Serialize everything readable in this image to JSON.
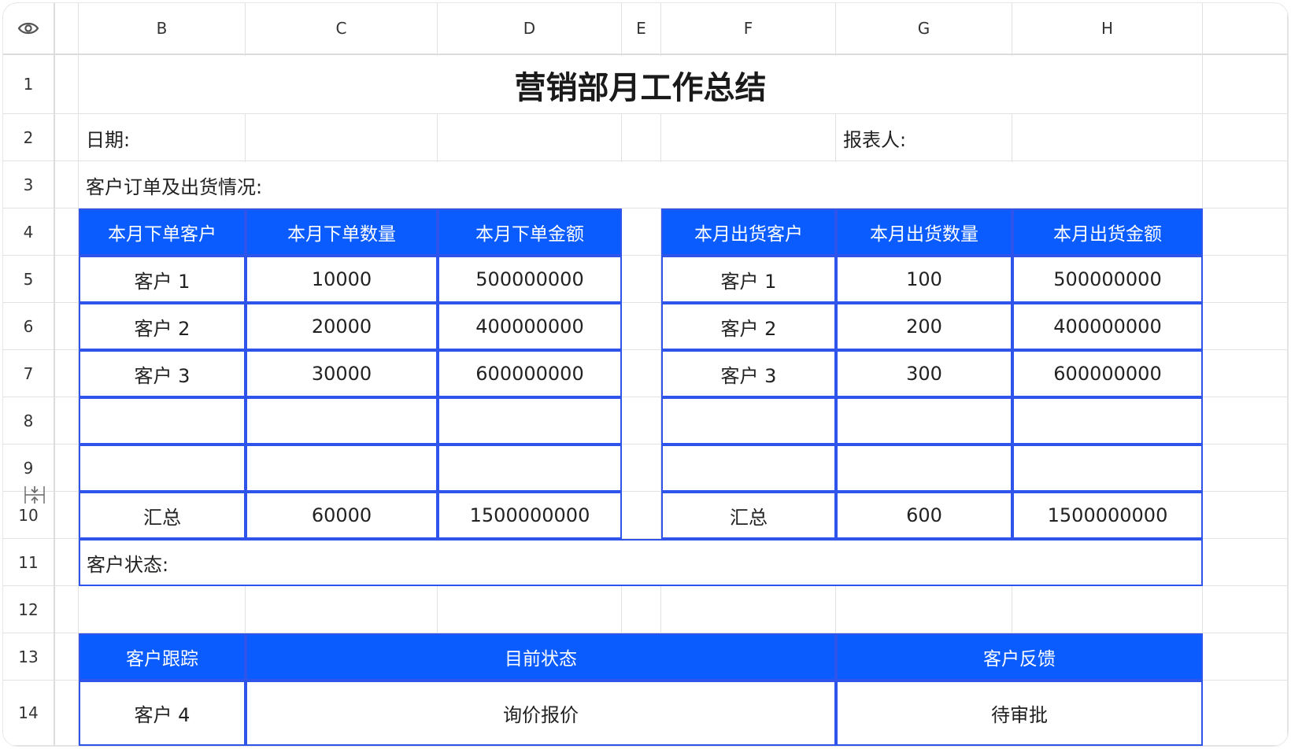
{
  "columns": [
    "B",
    "C",
    "D",
    "E",
    "F",
    "G",
    "H"
  ],
  "rows": [
    "1",
    "2",
    "3",
    "4",
    "5",
    "6",
    "7",
    "8",
    "9",
    "10",
    "11",
    "12",
    "13",
    "14"
  ],
  "title": "营销部月工作总结",
  "row2": {
    "date_label": "日期:",
    "reporter_label": "报表人:"
  },
  "row3": {
    "section_label": "客户订单及出货情况:"
  },
  "orders": {
    "headers": [
      "本月下单客户",
      "本月下单数量",
      "本月下单金额"
    ],
    "rows": [
      [
        "客户 1",
        "10000",
        "500000000"
      ],
      [
        "客户 2",
        "20000",
        "400000000"
      ],
      [
        "客户 3",
        "30000",
        "600000000"
      ],
      [
        "",
        "",
        ""
      ],
      [
        "",
        "",
        ""
      ]
    ],
    "total": [
      "汇总",
      "60000",
      "1500000000"
    ]
  },
  "shipments": {
    "headers": [
      "本月出货客户",
      "本月出货数量",
      "本月出货金额"
    ],
    "rows": [
      [
        "客户 1",
        "100",
        "500000000"
      ],
      [
        "客户 2",
        "200",
        "400000000"
      ],
      [
        "客户 3",
        "300",
        "600000000"
      ],
      [
        "",
        "",
        ""
      ],
      [
        "",
        "",
        ""
      ]
    ],
    "total": [
      "汇总",
      "600",
      "1500000000"
    ]
  },
  "row11": {
    "status_label": "客户状态:"
  },
  "tracking": {
    "headers": [
      "客户跟踪",
      "目前状态",
      "客户反馈"
    ],
    "rows": [
      [
        "客户 4",
        "询价报价",
        "待审批"
      ]
    ]
  },
  "colors": {
    "header_blue": "#0a5cff",
    "border_blue": "#2f54eb"
  },
  "icons": {
    "corner": "eye-icon",
    "row_resize": "row-resize-icon"
  }
}
